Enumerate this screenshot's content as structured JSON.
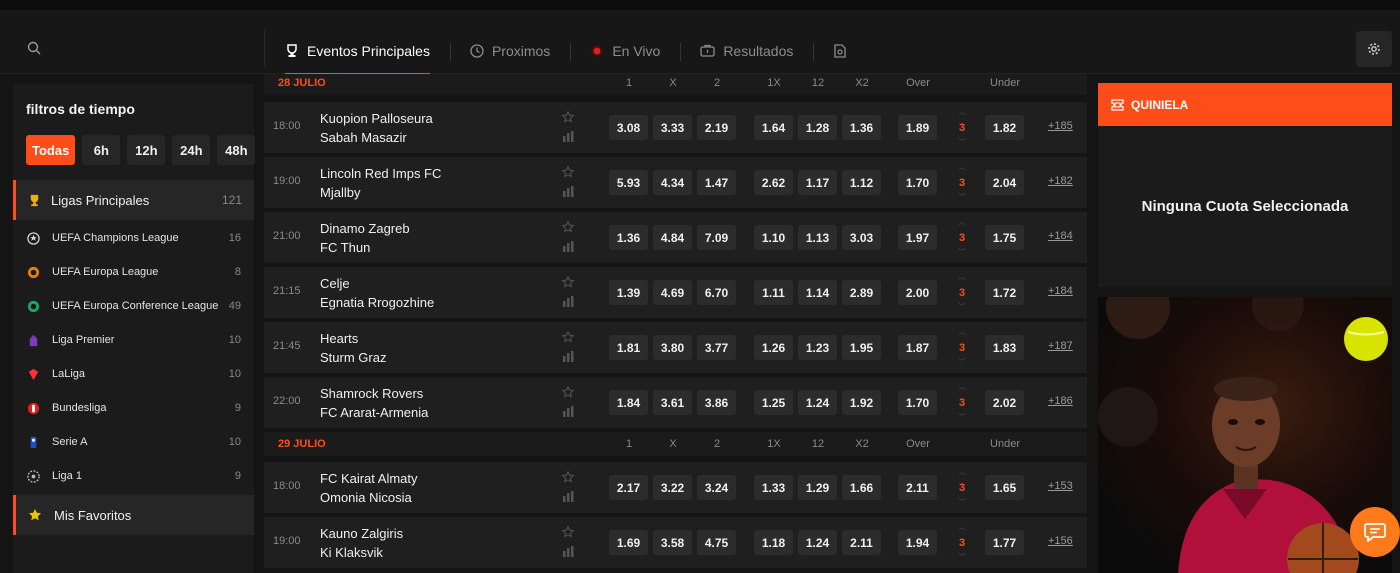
{
  "header": {
    "tabs": [
      {
        "label": "Eventos Principales",
        "icon": "trophy-icon",
        "active": true
      },
      {
        "label": "Proximos",
        "icon": "clock-icon"
      },
      {
        "label": "En Vivo",
        "icon": "live-dot-icon"
      },
      {
        "label": "Resultados",
        "icon": "results-icon"
      },
      {
        "label": "",
        "icon": "betslip-icon"
      }
    ]
  },
  "sidebar": {
    "title": "filtros de tiempo",
    "filters": [
      "Todas",
      "6h",
      "12h",
      "24h",
      "48h"
    ],
    "main": {
      "label": "Ligas Principales",
      "count": "121"
    },
    "leagues": [
      {
        "label": "UEFA Champions League",
        "count": "16"
      },
      {
        "label": "UEFA Europa League",
        "count": "8"
      },
      {
        "label": "UEFA Europa Conference League",
        "count": "49"
      },
      {
        "label": "Liga Premier",
        "count": "10"
      },
      {
        "label": "LaLiga",
        "count": "10"
      },
      {
        "label": "Bundesliga",
        "count": "9"
      },
      {
        "label": "Serie A",
        "count": "10"
      },
      {
        "label": "Liga 1",
        "count": "9"
      }
    ],
    "favorites": "Mis Favoritos"
  },
  "columns": [
    "1",
    "X",
    "2",
    "1X",
    "12",
    "X2",
    "Over",
    "Under"
  ],
  "sections": [
    {
      "date": "28 JULIO",
      "matches": [
        {
          "time": "18:00",
          "home": "Kuopion Palloseura",
          "away": "Sabah Masazir",
          "odds": [
            "3.08",
            "3.33",
            "2.19",
            "1.64",
            "1.28",
            "1.36",
            "1.89",
            "1.82"
          ],
          "goals": "3",
          "more": "+185"
        },
        {
          "time": "19:00",
          "home": "Lincoln Red Imps FC",
          "away": "Mjallby",
          "odds": [
            "5.93",
            "4.34",
            "1.47",
            "2.62",
            "1.17",
            "1.12",
            "1.70",
            "2.04"
          ],
          "goals": "3",
          "more": "+182"
        },
        {
          "time": "21:00",
          "home": "Dinamo Zagreb",
          "away": "FC Thun",
          "odds": [
            "1.36",
            "4.84",
            "7.09",
            "1.10",
            "1.13",
            "3.03",
            "1.97",
            "1.75"
          ],
          "goals": "3",
          "more": "+184"
        },
        {
          "time": "21:15",
          "home": "Celje",
          "away": "Egnatia Rrogozhine",
          "odds": [
            "1.39",
            "4.69",
            "6.70",
            "1.11",
            "1.14",
            "2.89",
            "2.00",
            "1.72"
          ],
          "goals": "3",
          "more": "+184"
        },
        {
          "time": "21:45",
          "home": "Hearts",
          "away": "Sturm Graz",
          "odds": [
            "1.81",
            "3.80",
            "3.77",
            "1.26",
            "1.23",
            "1.95",
            "1.87",
            "1.83"
          ],
          "goals": "3",
          "more": "+187"
        },
        {
          "time": "22:00",
          "home": "Shamrock Rovers",
          "away": "FC Ararat-Armenia",
          "odds": [
            "1.84",
            "3.61",
            "3.86",
            "1.25",
            "1.24",
            "1.92",
            "1.70",
            "2.02"
          ],
          "goals": "3",
          "more": "+186"
        }
      ]
    },
    {
      "date": "29 JULIO",
      "matches": [
        {
          "time": "18:00",
          "home": "FC Kairat Almaty",
          "away": "Omonia Nicosia",
          "odds": [
            "2.17",
            "3.22",
            "3.24",
            "1.33",
            "1.29",
            "1.66",
            "2.11",
            "1.65"
          ],
          "goals": "3",
          "more": "+153"
        },
        {
          "time": "19:00",
          "home": "Kauno Zalgiris",
          "away": "Ki Klaksvik",
          "odds": [
            "1.69",
            "3.58",
            "4.75",
            "1.18",
            "1.24",
            "2.11",
            "1.94",
            "1.77"
          ],
          "goals": "3",
          "more": "+156"
        }
      ]
    }
  ],
  "quiniela": {
    "title": "QUINIELA",
    "empty": "Ninguna Cuota Seleccionada"
  },
  "colors": {
    "accent": "#ff4d1a",
    "background": "#141414",
    "panel": "#1f1f1f",
    "odd_button": "#2c2c2c"
  }
}
